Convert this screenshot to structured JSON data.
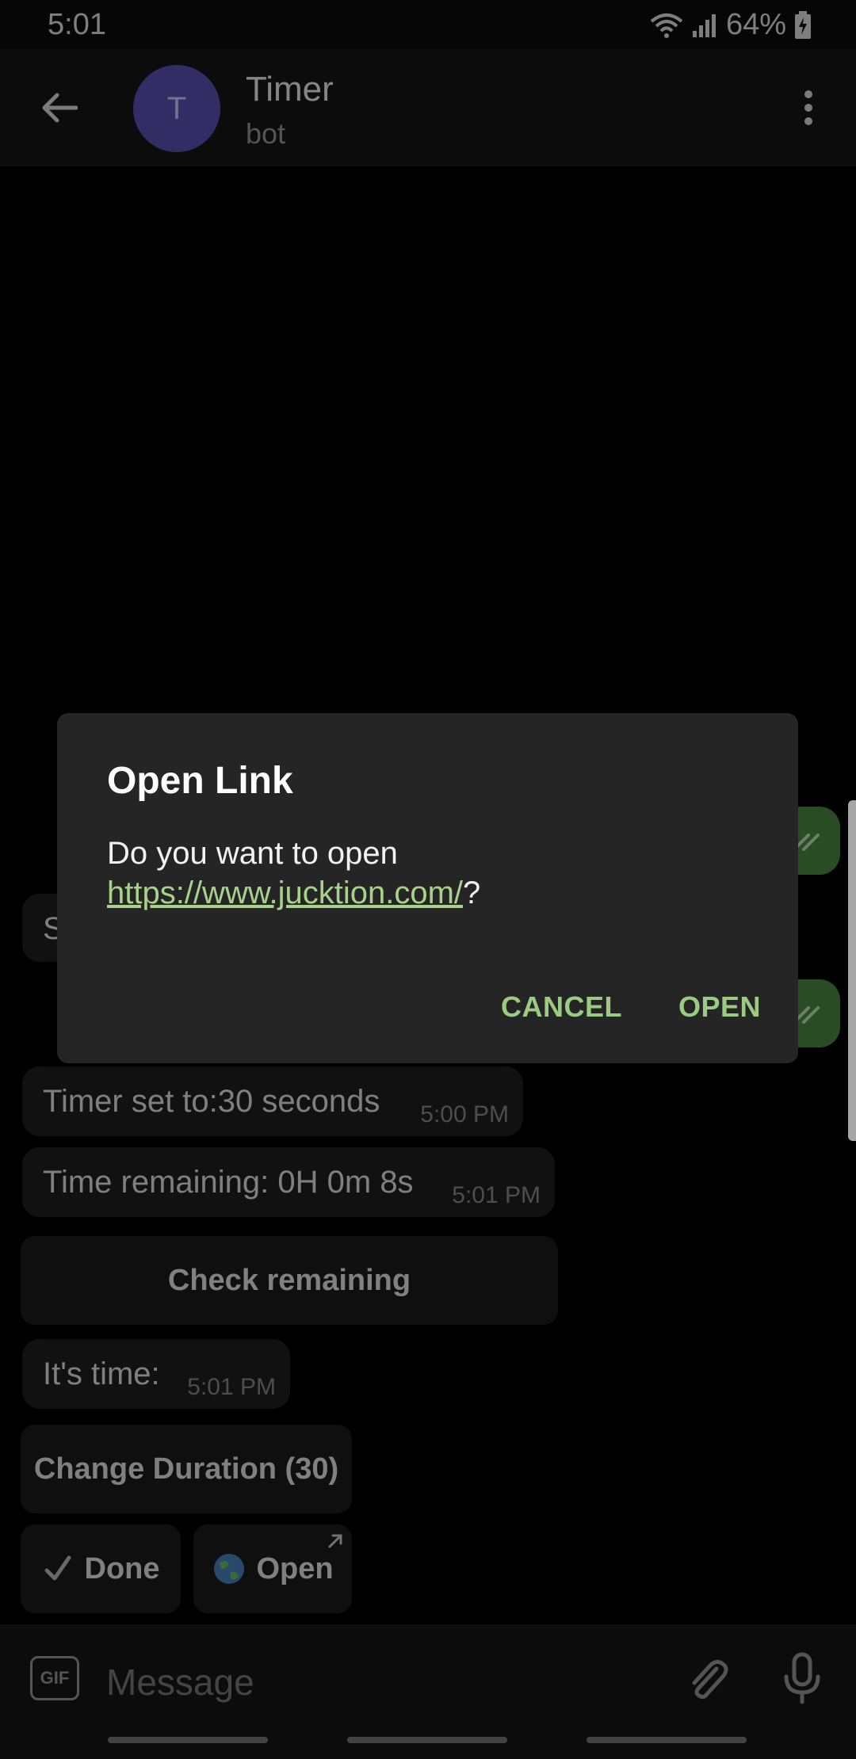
{
  "status_bar": {
    "time": "5:01",
    "battery_percent": "64%"
  },
  "header": {
    "avatar_letter": "T",
    "title": "Timer",
    "subtitle": "bot"
  },
  "messages": {
    "partial_left": "S",
    "timer_set": {
      "text": "Timer set to:30 seconds",
      "time": "5:00 PM"
    },
    "remaining": {
      "text": "Time remaining: 0H 0m 8s",
      "time": "5:01 PM"
    },
    "its_time": {
      "text": "It's time:",
      "time": "5:01 PM"
    }
  },
  "keyboard": {
    "check_remaining": "Check remaining",
    "change_duration": "Change Duration (30)",
    "done": "Done",
    "open": "Open"
  },
  "composer": {
    "placeholder": "Message",
    "gif_label": "GIF"
  },
  "dialog": {
    "title": "Open Link",
    "body_prefix": "Do you want to open",
    "url": "https://www.jucktion.com/",
    "body_suffix": "?",
    "cancel": "CANCEL",
    "open": "OPEN"
  },
  "colors": {
    "accent": "#9bcb83",
    "avatar": "#5b53b9",
    "outgoing_bubble": "#4d8b44",
    "dialog_bg": "#252525"
  }
}
